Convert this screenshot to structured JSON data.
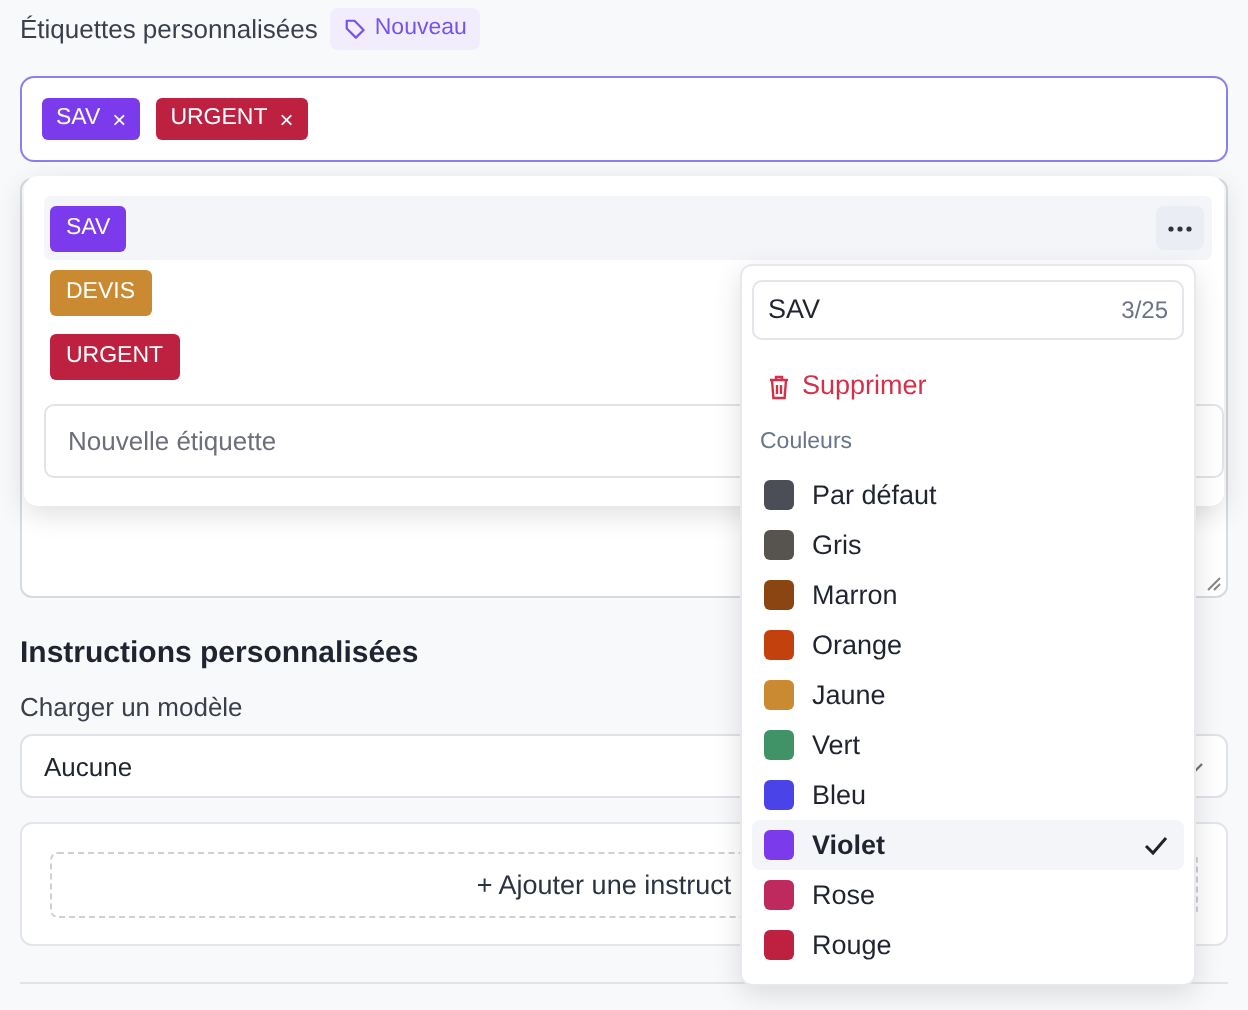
{
  "tags_label": "Étiquettes personnalisées",
  "new_badge": "Nouveau",
  "selected_tags": [
    {
      "label": "SAV",
      "remove": "×",
      "color": "#7c3aed"
    },
    {
      "label": "URGENT",
      "remove": "×",
      "color": "#be2040"
    }
  ],
  "tag_options": [
    {
      "label": "SAV",
      "color": "#7c3aed",
      "selected": true
    },
    {
      "label": "DEVIS",
      "color": "#ca8a32",
      "selected": false
    },
    {
      "label": "URGENT",
      "color": "#be2040",
      "selected": false
    }
  ],
  "new_tag": {
    "placeholder": "Nouvelle étiquette"
  },
  "instructions_heading": "Instructions personnalisées",
  "template_label": "Charger un modèle",
  "template_value": "Aucune",
  "add_instruction": "+ Ajouter une instruct",
  "tag_editor": {
    "name": "SAV",
    "counter": "3/25",
    "delete": "Supprimer",
    "colors_heading": "Couleurs",
    "colors": [
      {
        "label": "Par défaut",
        "color": "#4b4d57",
        "selected": false
      },
      {
        "label": "Gris",
        "color": "#57534e",
        "selected": false
      },
      {
        "label": "Marron",
        "color": "#8b4513",
        "selected": false
      },
      {
        "label": "Orange",
        "color": "#c2410c",
        "selected": false
      },
      {
        "label": "Jaune",
        "color": "#ca8a32",
        "selected": false
      },
      {
        "label": "Vert",
        "color": "#3f9366",
        "selected": false
      },
      {
        "label": "Bleu",
        "color": "#4a44e8",
        "selected": false
      },
      {
        "label": "Violet",
        "color": "#7c3aed",
        "selected": true
      },
      {
        "label": "Rose",
        "color": "#be2a5e",
        "selected": false
      },
      {
        "label": "Rouge",
        "color": "#be2040",
        "selected": false
      }
    ]
  }
}
